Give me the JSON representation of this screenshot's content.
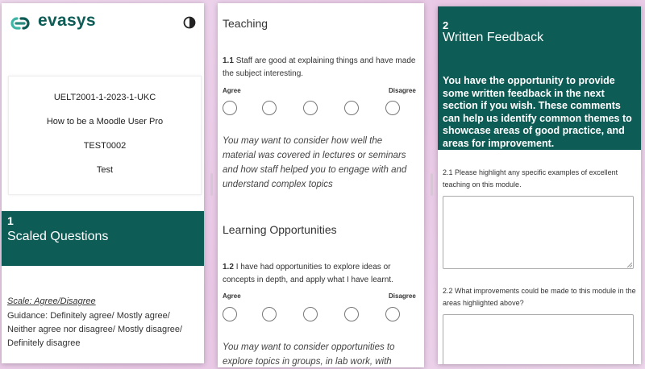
{
  "brand": {
    "name": "evasys",
    "color": "#0e5c56"
  },
  "header": {
    "contrast_icon": "contrast-icon",
    "logo_icon": "chain-link-icon"
  },
  "course": {
    "code": "UELT2001-1-2023-1-UKC",
    "name": "How to be a Moodle User Pro",
    "id": "TEST0002",
    "type": "Test"
  },
  "section1": {
    "number": "1",
    "title": "Scaled Questions",
    "scale_label": "Scale: Agree/Disagree",
    "guidance": "Guidance: Definitely agree/ Mostly agree/ Neither agree nor disagree/ Mostly disagree/ Definitely disagree"
  },
  "teaching": {
    "heading": "Teaching",
    "q_num": "1.1",
    "q_text": "Staff are good at explaining things and have made the subject interesting.",
    "agree": "Agree",
    "disagree": "Disagree",
    "hint": "You may want to consider how well the material was covered in lectures or seminars and how staff helped you to engage with and understand complex topics"
  },
  "learning": {
    "heading": "Learning Opportunities",
    "q_num": "1.2",
    "q_text": "I have had opportunities to explore ideas or concepts in depth, and apply what I have learnt.",
    "agree": "Agree",
    "disagree": "Disagree",
    "hint": "You may want to consider opportunities to explore topics in groups, in lab work, with"
  },
  "section2": {
    "number": "2",
    "title": "Written Feedback",
    "description": "You have the opportunity to provide some written feedback in the next section if you wish. These comments can help us identify common themes to showcase areas of good practice, and areas for improvement.",
    "q1": "2.1 Please highlight any specific examples of excellent teaching on this module.",
    "q2": "2.2 What improvements could be made to this module in the areas highlighted above?",
    "q1_value": "",
    "q2_value": ""
  }
}
